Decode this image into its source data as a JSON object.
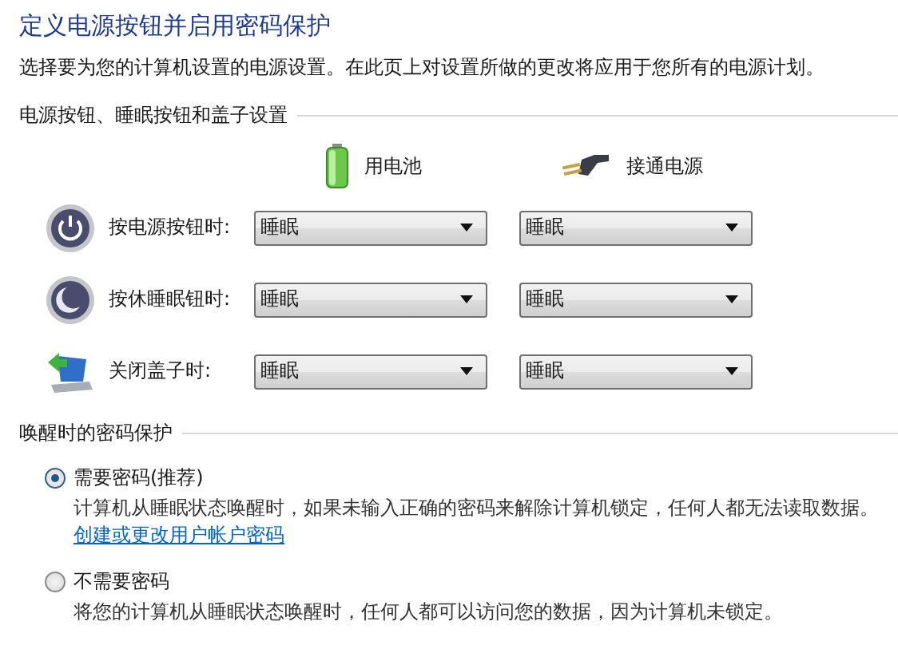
{
  "title": "定义电源按钮并启用密码保护",
  "description": "选择要为您的计算机设置的电源设置。在此页上对设置所做的更改将应用于您所有的电源计划。",
  "button_section": {
    "heading": "电源按钮、睡眠按钮和盖子设置",
    "columns": [
      {
        "label": "用电池",
        "kind": "battery"
      },
      {
        "label": "接通电源",
        "kind": "plug"
      }
    ],
    "rows": [
      {
        "label": "按电源按钮时:",
        "kind": "power",
        "values": [
          "睡眠",
          "睡眠"
        ]
      },
      {
        "label": "按休睡眠钮时:",
        "kind": "sleep",
        "values": [
          "睡眠",
          "睡眠"
        ]
      },
      {
        "label": "关闭盖子时:",
        "kind": "lid",
        "values": [
          "睡眠",
          "睡眠"
        ]
      }
    ]
  },
  "password_section": {
    "heading": "唤醒时的密码保护",
    "options": [
      {
        "label": "需要密码(推荐)",
        "selected": true,
        "description": "计算机从睡眠状态唤醒时，如果未输入正确的密码来解除计算机锁定，任何人都无法读取数据。",
        "link": "创建或更改用户帐户密码"
      },
      {
        "label": "不需要密码",
        "selected": false,
        "description": "将您的计算机从睡眠状态唤醒时，任何人都可以访问您的数据，因为计算机未锁定。"
      }
    ]
  }
}
